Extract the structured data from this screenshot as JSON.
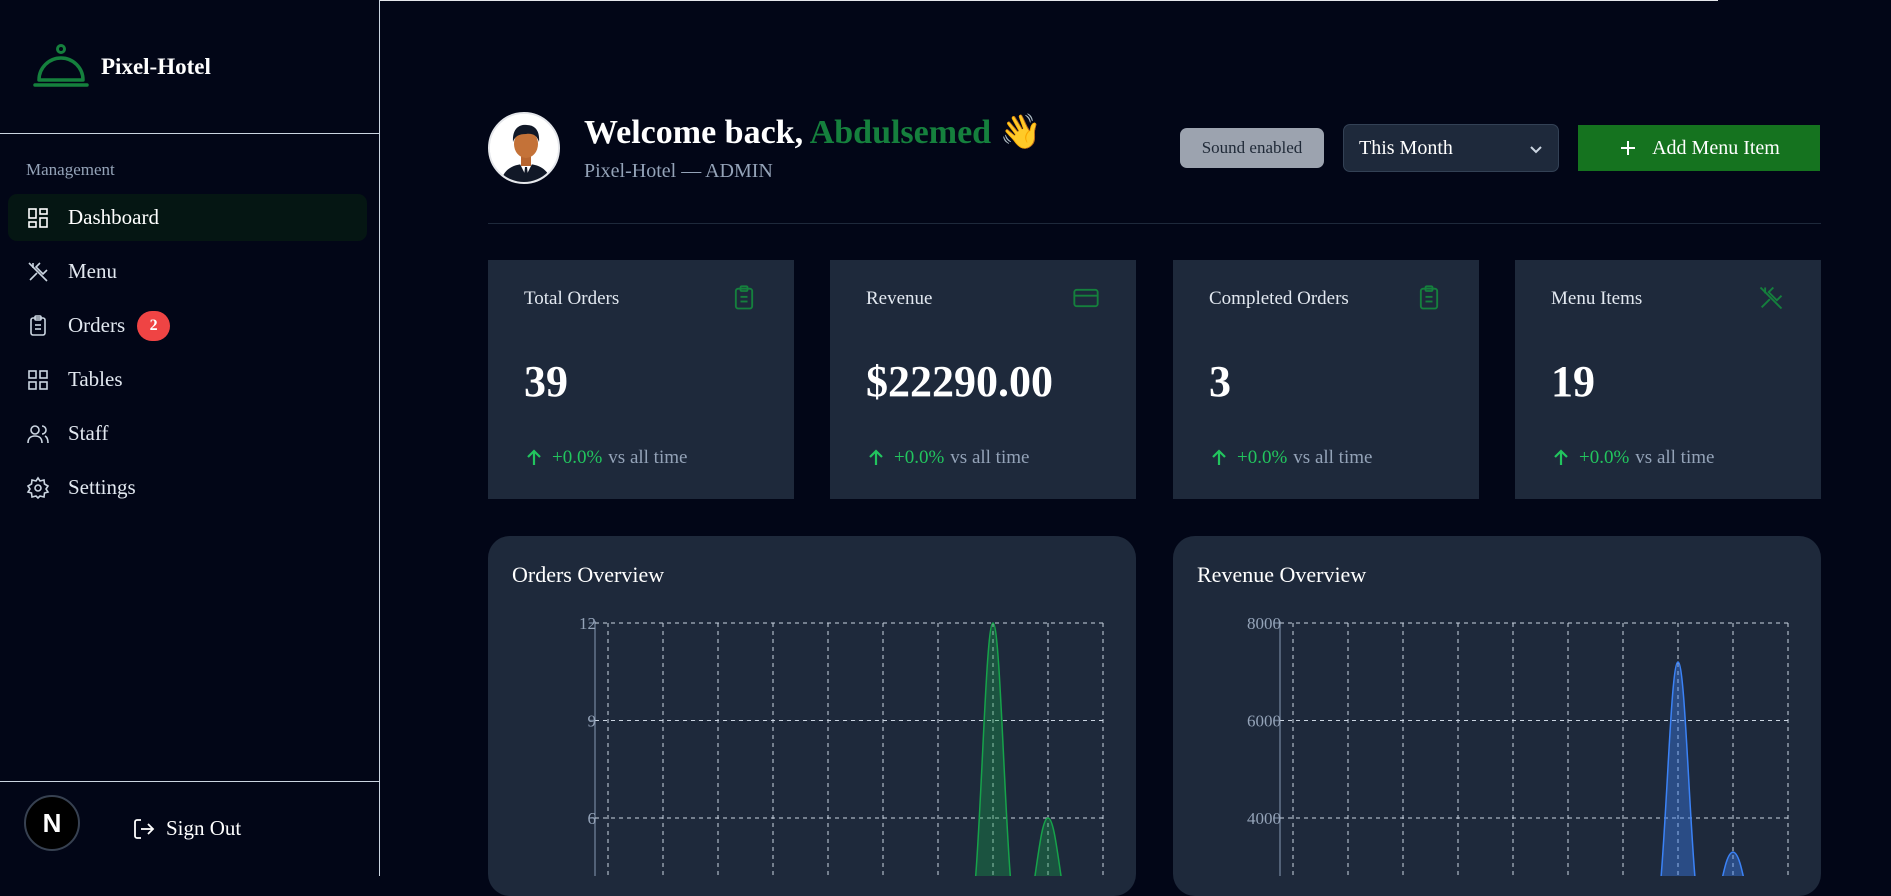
{
  "brand": {
    "name": "Pixel-Hotel",
    "logo_icon": "cloche-icon"
  },
  "sidebar": {
    "section_title": "Management",
    "items": [
      {
        "label": "Dashboard",
        "icon": "dashboard-icon",
        "active": true
      },
      {
        "label": "Menu",
        "icon": "utensils-icon"
      },
      {
        "label": "Orders",
        "icon": "clipboard-icon",
        "badge": "2"
      },
      {
        "label": "Tables",
        "icon": "grid-icon"
      },
      {
        "label": "Staff",
        "icon": "users-icon"
      },
      {
        "label": "Settings",
        "icon": "gear-icon"
      }
    ],
    "footer": {
      "avatar_letter": "N",
      "sign_out": "Sign Out"
    }
  },
  "header": {
    "welcome": "Welcome back,",
    "user_name": "Abdulsemed",
    "wave": "👋",
    "subtitle": "Pixel-Hotel — ADMIN",
    "sound_status": "Sound enabled",
    "period": "This Month",
    "add_button": "Add Menu Item"
  },
  "stats": [
    {
      "label": "Total Orders",
      "value": "39",
      "delta": "+0.0%",
      "delta_suffix": "vs all time",
      "icon": "clipboard-icon"
    },
    {
      "label": "Revenue",
      "value": "$22290.00",
      "delta": "+0.0%",
      "delta_suffix": "vs all time",
      "icon": "credit-card-icon"
    },
    {
      "label": "Completed Orders",
      "value": "3",
      "delta": "+0.0%",
      "delta_suffix": "vs all time",
      "icon": "clipboard-icon"
    },
    {
      "label": "Menu Items",
      "value": "19",
      "delta": "+0.0%",
      "delta_suffix": "vs all time",
      "icon": "utensils-icon"
    }
  ],
  "colors": {
    "accent": "#15803d",
    "positive": "#22c55e",
    "orders_series": "#16a34a",
    "revenue_series": "#3b82f6",
    "badge": "#ef4444"
  },
  "chart_data": [
    {
      "type": "area",
      "title": "Orders Overview",
      "x": [
        0,
        1,
        2,
        3,
        4,
        5,
        6,
        7,
        8,
        9
      ],
      "yticks": [
        6,
        9,
        12
      ],
      "ylim": [
        3,
        12
      ],
      "grid": true,
      "series": [
        {
          "values": [
            0,
            0,
            0,
            0,
            0,
            0,
            0,
            12,
            6,
            0
          ]
        }
      ]
    },
    {
      "type": "area",
      "title": "Revenue Overview",
      "x": [
        0,
        1,
        2,
        3,
        4,
        5,
        6,
        7,
        8,
        9
      ],
      "yticks": [
        4000,
        6000,
        8000
      ],
      "ylim": [
        2000,
        8000
      ],
      "grid": true,
      "series": [
        {
          "values": [
            0,
            0,
            0,
            0,
            0,
            0,
            0,
            7200,
            3300,
            0
          ]
        }
      ]
    }
  ]
}
